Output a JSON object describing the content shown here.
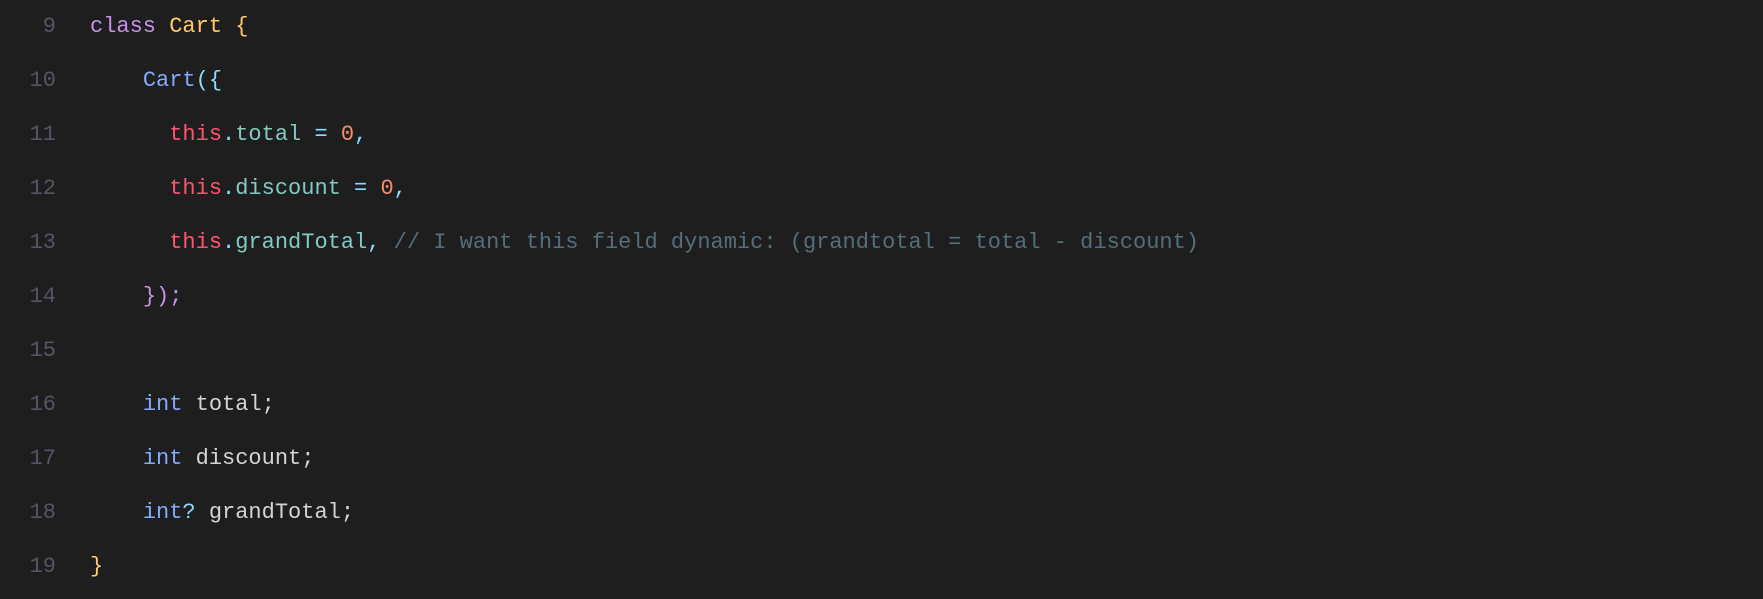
{
  "editor": {
    "background": "#1e1e1e",
    "lines": [
      {
        "number": "9",
        "tokens": [
          {
            "text": "class ",
            "type": "kw-class"
          },
          {
            "text": "Cart",
            "type": "class-name"
          },
          {
            "text": " {",
            "type": "brace-yellow"
          }
        ]
      },
      {
        "number": "10",
        "tokens": [
          {
            "text": "    ",
            "type": "plain"
          },
          {
            "text": "Cart",
            "type": "method-name"
          },
          {
            "text": "({",
            "type": "punctuation"
          }
        ]
      },
      {
        "number": "11",
        "tokens": [
          {
            "text": "      ",
            "type": "plain"
          },
          {
            "text": "this",
            "type": "keyword-this"
          },
          {
            "text": ".",
            "type": "operator"
          },
          {
            "text": "total",
            "type": "property"
          },
          {
            "text": " = ",
            "type": "operator"
          },
          {
            "text": "0",
            "type": "number"
          },
          {
            "text": ",",
            "type": "punctuation"
          }
        ]
      },
      {
        "number": "12",
        "tokens": [
          {
            "text": "      ",
            "type": "plain"
          },
          {
            "text": "this",
            "type": "keyword-this"
          },
          {
            "text": ".",
            "type": "operator"
          },
          {
            "text": "discount",
            "type": "property"
          },
          {
            "text": " = ",
            "type": "operator"
          },
          {
            "text": "0",
            "type": "number"
          },
          {
            "text": ",",
            "type": "punctuation"
          }
        ]
      },
      {
        "number": "13",
        "tokens": [
          {
            "text": "      ",
            "type": "plain"
          },
          {
            "text": "this",
            "type": "keyword-this"
          },
          {
            "text": ".",
            "type": "operator"
          },
          {
            "text": "grandTotal",
            "type": "property"
          },
          {
            "text": ", ",
            "type": "punctuation"
          },
          {
            "text": "// I want this field dynamic: (grandtotal = total - discount)",
            "type": "comment"
          }
        ]
      },
      {
        "number": "14",
        "tokens": [
          {
            "text": "    ",
            "type": "plain"
          },
          {
            "text": "});",
            "type": "brace-pink"
          }
        ]
      },
      {
        "number": "15",
        "tokens": []
      },
      {
        "number": "16",
        "tokens": [
          {
            "text": "    ",
            "type": "plain"
          },
          {
            "text": "int",
            "type": "kw-int"
          },
          {
            "text": " total;",
            "type": "plain"
          }
        ]
      },
      {
        "number": "17",
        "tokens": [
          {
            "text": "    ",
            "type": "plain"
          },
          {
            "text": "int",
            "type": "kw-int"
          },
          {
            "text": " discount;",
            "type": "plain"
          }
        ]
      },
      {
        "number": "18",
        "tokens": [
          {
            "text": "    ",
            "type": "plain"
          },
          {
            "text": "int",
            "type": "kw-int"
          },
          {
            "text": "?",
            "type": "nullable"
          },
          {
            "text": " grandTotal;",
            "type": "plain"
          }
        ]
      },
      {
        "number": "19",
        "tokens": [
          {
            "text": "}",
            "type": "brace-yellow"
          }
        ]
      }
    ]
  }
}
